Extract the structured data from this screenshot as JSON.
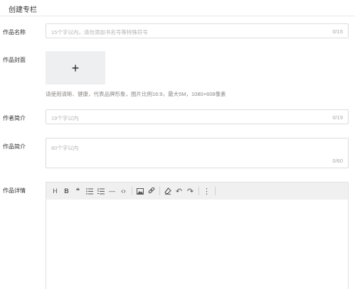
{
  "header": {
    "title": "创建专栏"
  },
  "work_name": {
    "label": "作品名称",
    "placeholder": "15个字以内，请勿添加书名号等特殊符号",
    "counter": "0/15"
  },
  "cover": {
    "label": "作品封面",
    "hint": "请使用清晰、健康，代表品牌形象，图片比例16:9，最大5M，1080×608像素"
  },
  "author_intro": {
    "label": "作者简介",
    "placeholder": "19个字以内",
    "counter": "0/19"
  },
  "work_intro": {
    "label": "作品简介",
    "placeholder": "60个字以内",
    "counter": "0/60"
  },
  "details": {
    "label": "作品详情",
    "toolbar": [
      {
        "name": "heading-icon",
        "glyph": "H"
      },
      {
        "name": "bold-icon",
        "glyph": "B"
      },
      {
        "name": "quote-icon",
        "glyph": "❝"
      },
      {
        "name": "bullet-list-icon",
        "glyph": ""
      },
      {
        "name": "ordered-list-icon",
        "glyph": ""
      },
      {
        "name": "horizontal-rule-icon",
        "glyph": "—"
      },
      {
        "name": "code-icon",
        "glyph": "‹›"
      },
      {
        "name": "image-icon",
        "glyph": ""
      },
      {
        "name": "link-icon",
        "glyph": ""
      },
      {
        "name": "clear-format-icon",
        "glyph": ""
      },
      {
        "name": "undo-icon",
        "glyph": "↶"
      },
      {
        "name": "redo-icon",
        "glyph": "↷"
      },
      {
        "name": "more-icon",
        "glyph": "⋮"
      }
    ]
  }
}
